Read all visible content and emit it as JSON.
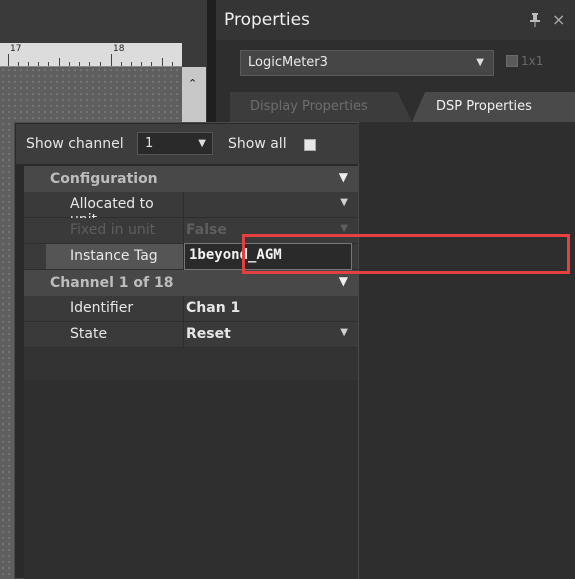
{
  "canvas": {
    "ruler_labels": [
      "17",
      "18"
    ]
  },
  "panel": {
    "title": "Properties",
    "object_selector": {
      "value": "LogicMeter3"
    },
    "grid_toggle_label": "1x1",
    "tabs": [
      {
        "label": "Display Properties",
        "active": false
      },
      {
        "label": "DSP Properties",
        "active": true
      }
    ],
    "channel_bar": {
      "show_channel_label": "Show channel",
      "channel_value": "1",
      "show_all_label": "Show all"
    },
    "sections": {
      "configuration": "Configuration",
      "channel": "Channel 1 of 18"
    },
    "properties": {
      "allocated_label": "Allocated to unit",
      "allocated_value": "",
      "fixed_label": "Fixed in unit",
      "fixed_value": "False",
      "instance_label": "Instance Tag",
      "instance_value": "1beyond_AGM",
      "identifier_label": "Identifier",
      "identifier_value": "Chan 1",
      "state_label": "State",
      "state_value": "Reset"
    }
  },
  "colors": {
    "highlight": "#e44040",
    "active_tab": "#4a4a4a",
    "panel_bg": "#2e2e2e"
  }
}
